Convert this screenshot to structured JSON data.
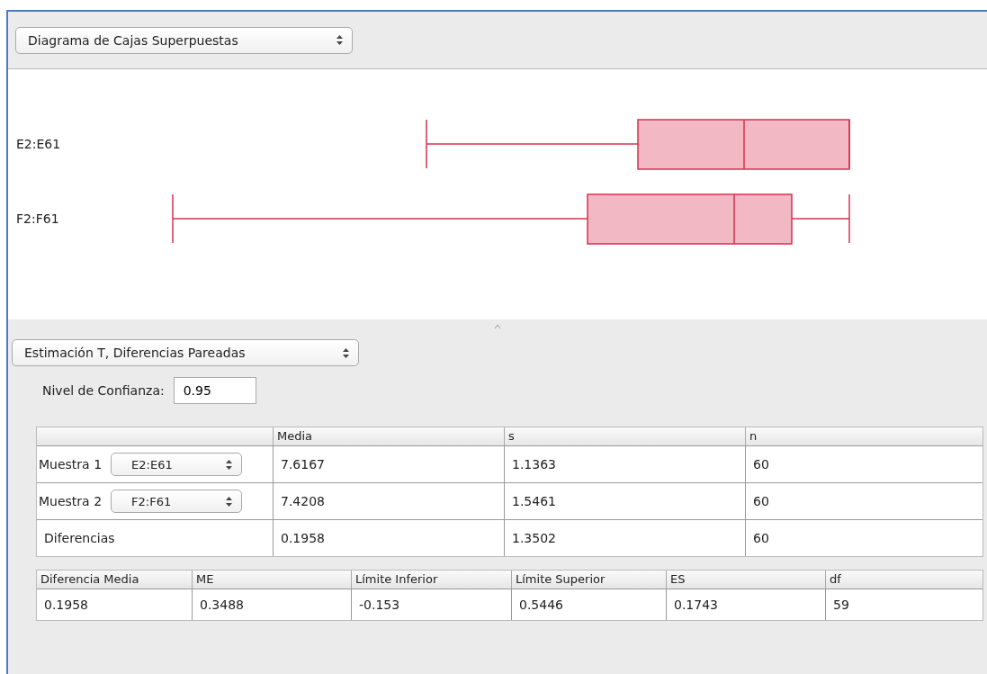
{
  "plot_selector": {
    "value": "Diagrama de Cajas Superpuestas"
  },
  "plot": {
    "series": [
      {
        "label": "E2:E61"
      },
      {
        "label": "F2:F61"
      }
    ]
  },
  "method_selector": {
    "value": "Estimación T, Diferencias Pareadas"
  },
  "confidence": {
    "label": "Nivel de Confianza:",
    "value": "0.95"
  },
  "summary_table": {
    "columns": [
      "Media",
      "s",
      "n"
    ],
    "rows": [
      {
        "kind": "select",
        "label": "Muestra 1",
        "selector": "E2:E61",
        "cells": [
          "7.6167",
          "1.1363",
          "60"
        ]
      },
      {
        "kind": "select",
        "label": "Muestra 2",
        "selector": "F2:F61",
        "cells": [
          "7.4208",
          "1.5461",
          "60"
        ]
      },
      {
        "kind": "plain",
        "label": "Diferencias",
        "cells": [
          "0.1958",
          "1.3502",
          "60"
        ]
      }
    ]
  },
  "result_table": {
    "columns": [
      "Diferencia Media",
      "ME",
      "Límite Inferior",
      "Límite Superior",
      "ES",
      "df"
    ],
    "rows": [
      [
        "0.1958",
        "0.3488",
        "-0.153",
        "0.5446",
        "0.1743",
        "59"
      ]
    ]
  }
}
